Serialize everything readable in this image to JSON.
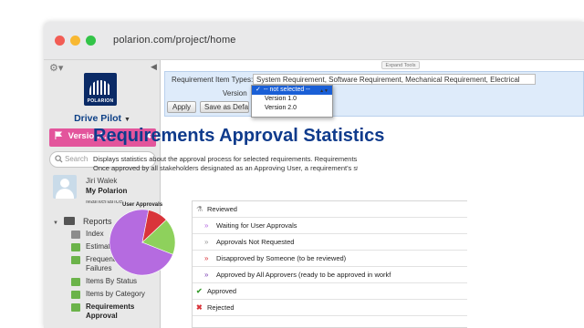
{
  "browser": {
    "url": "polarion.com/project/home"
  },
  "sidebar": {
    "logo_text": "POLARION",
    "project": "Drive Pilot",
    "version": "Version1.0",
    "search_placeholder": "Search",
    "user_name": "Jiri Walek",
    "my_polarion": "My Polarion",
    "cut_item": "Maintenance",
    "reports_label": "Reports",
    "items": [
      {
        "label": "Index",
        "icon": "doc-icon"
      },
      {
        "label": "Estimation Quality",
        "icon": "report-icon"
      },
      {
        "label": "Frequent Test Case Failures",
        "icon": "report-icon"
      },
      {
        "label": "Items By Status",
        "icon": "report-icon"
      },
      {
        "label": "Items by Category",
        "icon": "report-icon"
      },
      {
        "label": "Requirements Approval",
        "icon": "report-icon",
        "active": true
      }
    ]
  },
  "toolbar": {
    "expand_tools": "Expand Tools"
  },
  "filter": {
    "types_label": "Requirement Item Types:",
    "types_value": "System Requirement, Software Requirement, Mechanical Requirement, Electrical",
    "version_label": "Version",
    "apply": "Apply",
    "save_default": "Save as Default",
    "version_options": [
      "-- not selected --",
      "Version 1.0",
      "Version 2.0"
    ],
    "version_selected": "-- not selected --"
  },
  "content": {
    "title": "Requirements Approval Statistics",
    "desc_line1": "Displays statistics about the approval process for selected requirements. Requirements",
    "desc_line2": "Once approved by all stakeholders designated as an Approving User, a requirement's st"
  },
  "chart_data": {
    "type": "pie",
    "title": "User Approvals",
    "slices": [
      {
        "label": "Approved by All Approvers",
        "value": 72,
        "color": "#b56be0"
      },
      {
        "label": "Disapproved by Someone",
        "value": 10,
        "color": "#d9343a"
      },
      {
        "label": "Approved",
        "value": 18,
        "color": "#8ed15c"
      }
    ]
  },
  "legend": {
    "rows": [
      {
        "label": "Reviewed",
        "icon": "reviewed-icon",
        "level": 1
      },
      {
        "label": "Waiting for User Approvals",
        "icon": "chevron-right-icon",
        "level": 2
      },
      {
        "label": "Approvals Not Requested",
        "icon": "chevron-right-icon",
        "level": 2
      },
      {
        "label": "Disapproved by Someone (to be reviewed)",
        "icon": "chevron-right-icon",
        "level": 2
      },
      {
        "label": "Approved by All Approvers (ready to be approved in workf",
        "icon": "chevron-right-icon",
        "level": 2
      },
      {
        "label": "Approved",
        "icon": "check-icon",
        "level": 1
      },
      {
        "label": "Rejected",
        "icon": "x-icon",
        "level": 1
      }
    ]
  },
  "colors": {
    "accent": "#0f3b8c",
    "version_badge": "#e3559c",
    "panel": "#deebfa"
  }
}
